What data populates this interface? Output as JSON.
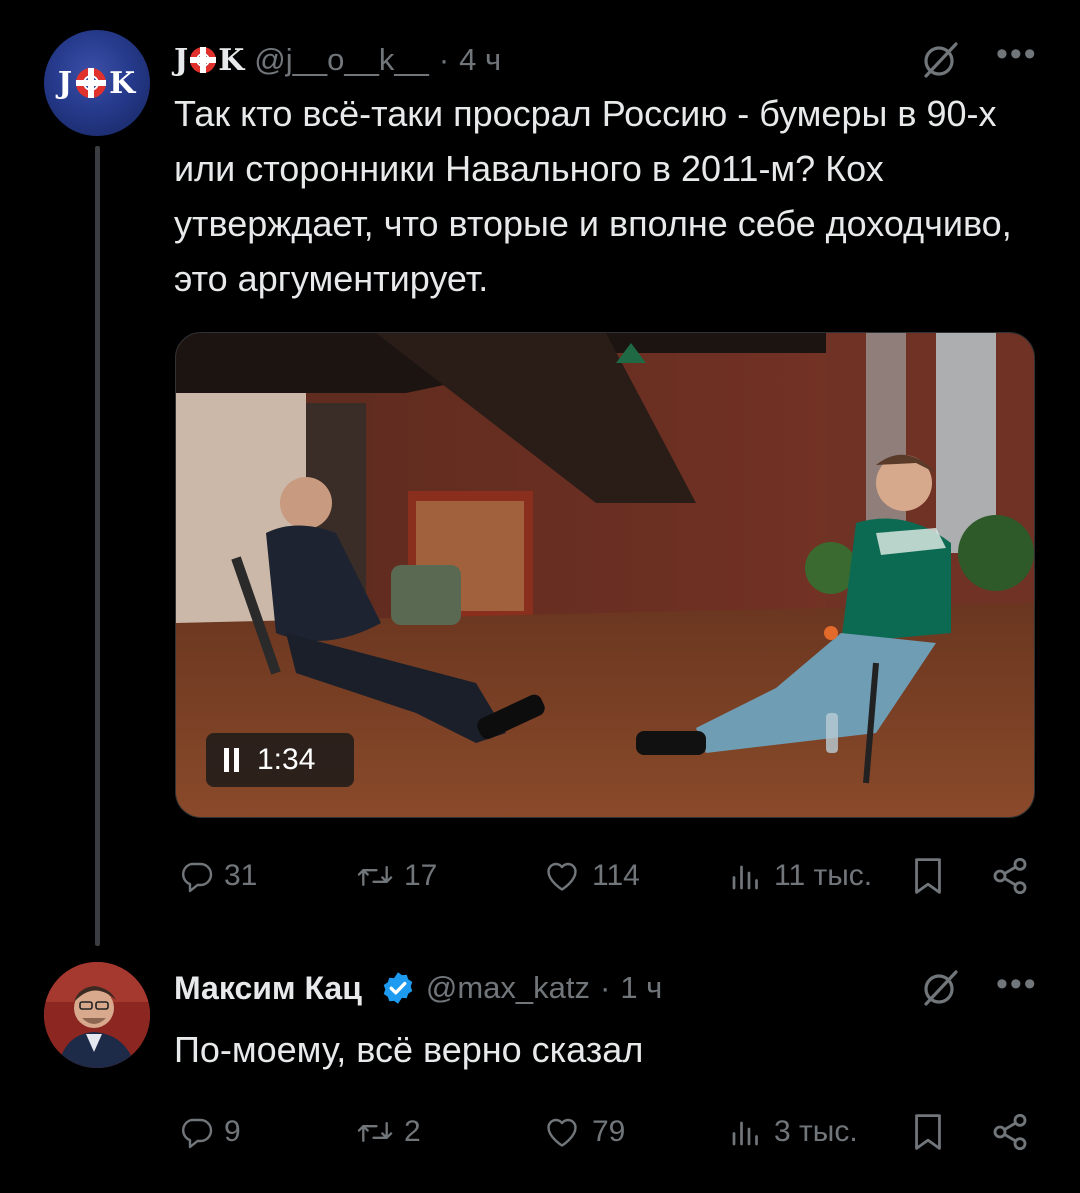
{
  "tweets": [
    {
      "author_name": "JOK",
      "name_letters": [
        "J",
        "K"
      ],
      "avatar_letters": [
        "J",
        "K"
      ],
      "handle": "@j__o__k__",
      "separator": "·",
      "time": "4 ч",
      "text": "Так кто всё-таки просрал Россию - бумеры в 90-х или сторонники Навального в 2011-м? Кох утверждает, что вторые и вполне себе доходчиво, это аргументирует.",
      "video": {
        "duration": "1:34",
        "state_icon": "pause-icon"
      },
      "replies": "31",
      "reposts": "17",
      "likes": "114",
      "views": "11 тыс."
    },
    {
      "author_name": "Максим Кац",
      "verified": true,
      "handle": "@max_katz",
      "separator": "·",
      "time": "1 ч",
      "text": "По-моему, всё верно сказал",
      "replies": "9",
      "reposts": "2",
      "likes": "79",
      "views": "3 тыс."
    }
  ],
  "colors": {
    "background": "#000000",
    "text": "#e7e9ea",
    "muted": "#71767b",
    "verified_blue": "#1d9bf0",
    "thread_line": "#3a3d41"
  },
  "icons": [
    "grok-icon",
    "more-icon",
    "reply-icon",
    "repost-icon",
    "like-icon",
    "views-icon",
    "bookmark-icon",
    "share-icon",
    "verified-badge-icon",
    "pause-icon"
  ]
}
